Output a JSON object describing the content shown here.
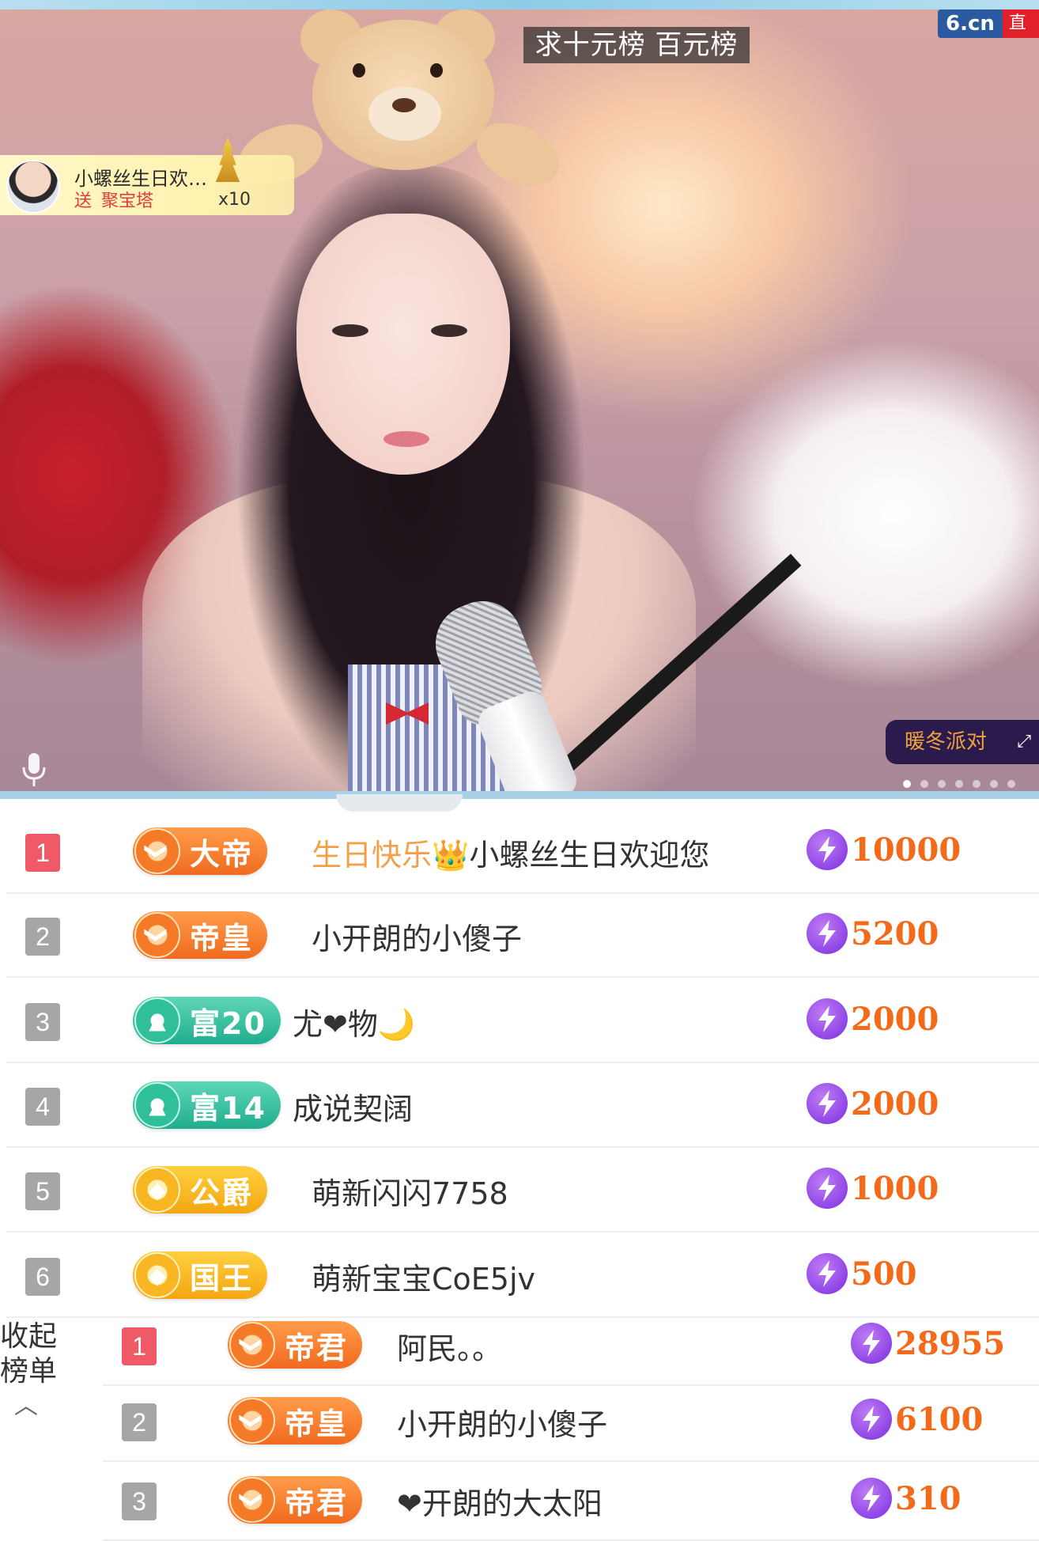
{
  "stream": {
    "request_banner": "求十元榜 百元榜",
    "logo_main": "6.cn",
    "logo_tag": "直播",
    "gift_toast": {
      "user": "小螺丝生日欢…",
      "send_label": "送",
      "gift_name": "聚宝塔",
      "count": "x10"
    },
    "party_button": "暖冬派对",
    "expand_icon": "⤢",
    "carousel_dots": 7,
    "carousel_active": 0
  },
  "rank_list": [
    {
      "rank": "1",
      "badge": "大帝",
      "badge_style": "orange",
      "name_prefix": "生日快乐",
      "name": "小螺丝生日欢迎您",
      "score": "10000"
    },
    {
      "rank": "2",
      "badge": "帝皇",
      "badge_style": "orange",
      "name_prefix": "",
      "name": "小开朗的小傻子",
      "score": "5200"
    },
    {
      "rank": "3",
      "badge": "富20",
      "badge_style": "teal",
      "name_prefix": "",
      "name": "尤❤物🌙",
      "score": "2000"
    },
    {
      "rank": "4",
      "badge": "富14",
      "badge_style": "teal",
      "name_prefix": "",
      "name": "成说契阔",
      "score": "2000"
    },
    {
      "rank": "5",
      "badge": "公爵",
      "badge_style": "gold",
      "name_prefix": "",
      "name": "萌新闪闪7758",
      "score": "1000"
    },
    {
      "rank": "6",
      "badge": "国王",
      "badge_style": "gold",
      "name_prefix": "",
      "name": "萌新宝宝CoE5jv",
      "score": "500"
    }
  ],
  "collapse": {
    "line1": "收起",
    "line2": "榜单",
    "chevron": "︿"
  },
  "sub_rank_list": [
    {
      "rank": "1",
      "badge": "帝君",
      "name": "阿民。。",
      "score": "28955"
    },
    {
      "rank": "2",
      "badge": "帝皇",
      "name": "小开朗的小傻子",
      "score": "6100"
    },
    {
      "rank": "3",
      "badge": "帝君",
      "name": "❤开朗的大太阳",
      "score": "310"
    }
  ],
  "colors": {
    "accent_orange": "#f26a1a",
    "rank_first": "#ef5a66",
    "bolt_purple": "#7a2ee0"
  }
}
